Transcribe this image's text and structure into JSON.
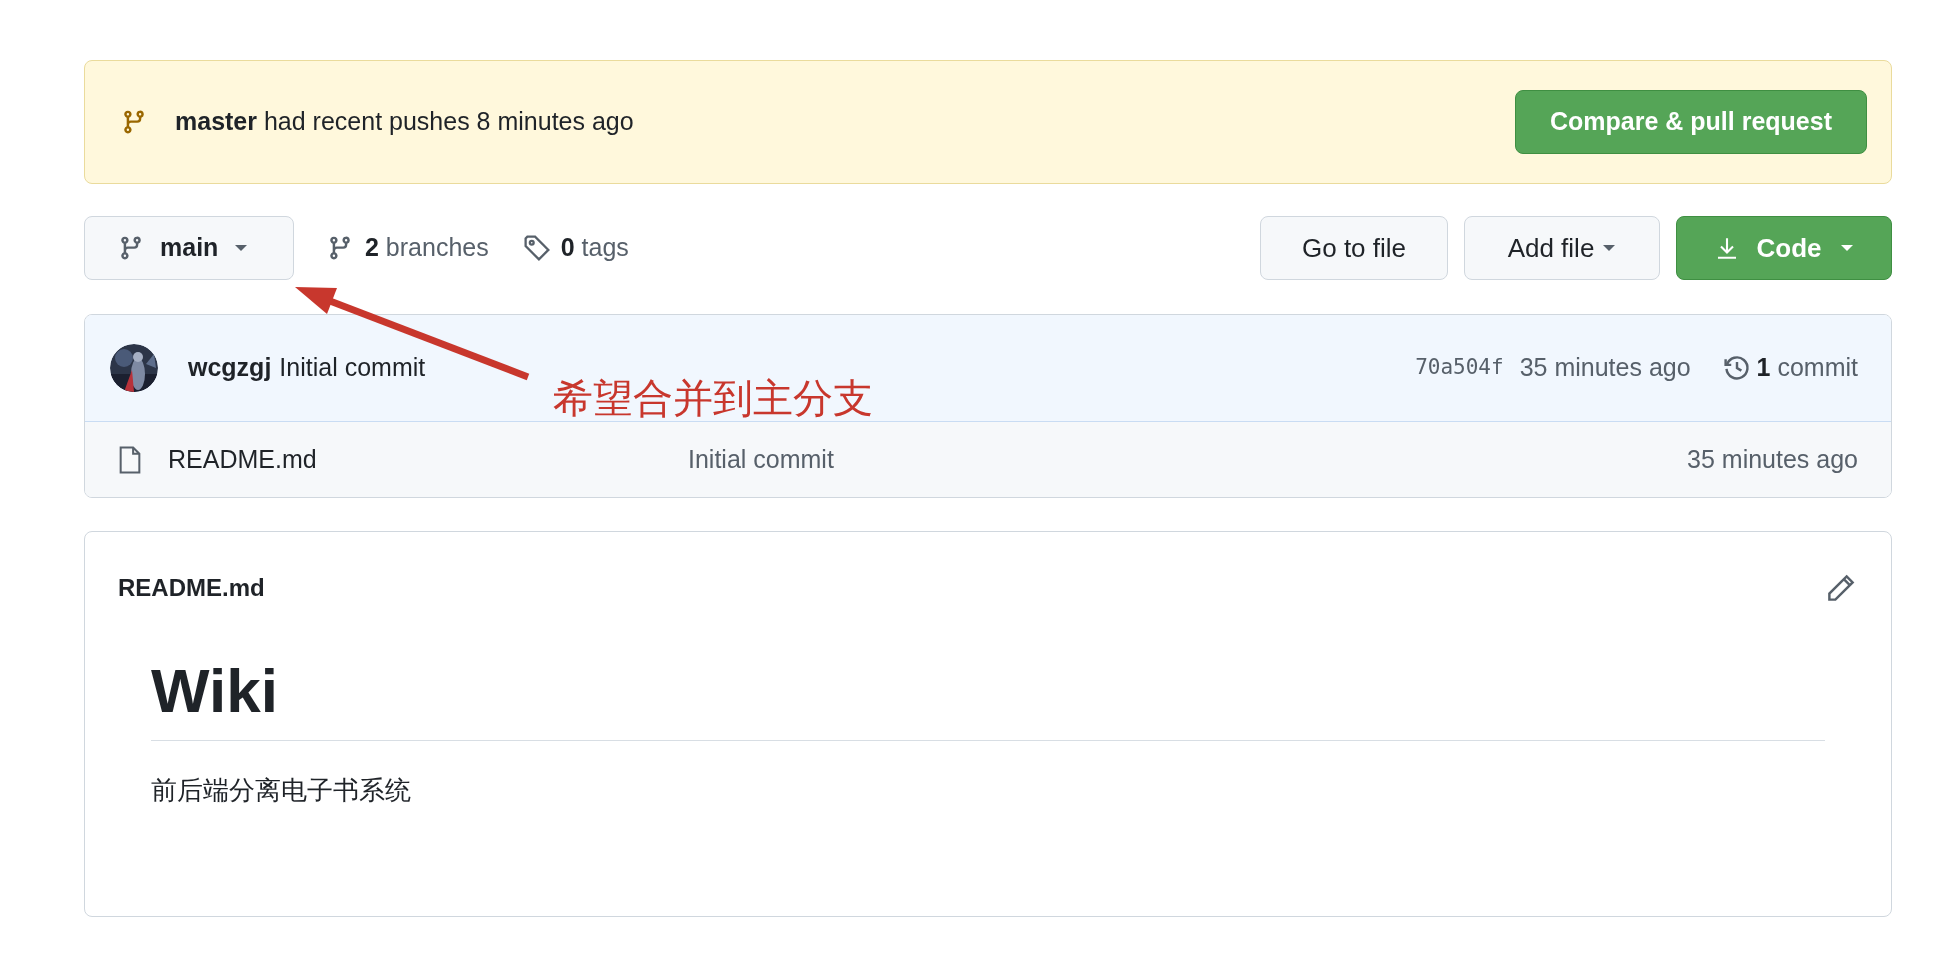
{
  "banner": {
    "branch": "master",
    "message": "had recent pushes 8 minutes ago",
    "button": "Compare & pull request"
  },
  "toolbar": {
    "branch_button": "main",
    "branches_count": "2",
    "branches_label": "branches",
    "tags_count": "0",
    "tags_label": "tags",
    "buttons": [
      {
        "label": "Go to file",
        "kind": "plain"
      },
      {
        "label": "Add file",
        "kind": "dropdown"
      },
      {
        "label": "Code",
        "kind": "primary"
      }
    ]
  },
  "latest_commit": {
    "author": "wcgzgj",
    "message": "Initial commit",
    "sha": "70a504f",
    "time": "35 minutes ago",
    "count": "1",
    "count_label": "commit"
  },
  "files": [
    {
      "name": "README.md",
      "commit_message": "Initial commit",
      "time": "35 minutes ago"
    }
  ],
  "readme": {
    "filename": "README.md",
    "heading": "Wiki",
    "paragraph": "前后端分离电子书系统"
  },
  "annotation": {
    "text": "希望合并到主分支"
  }
}
